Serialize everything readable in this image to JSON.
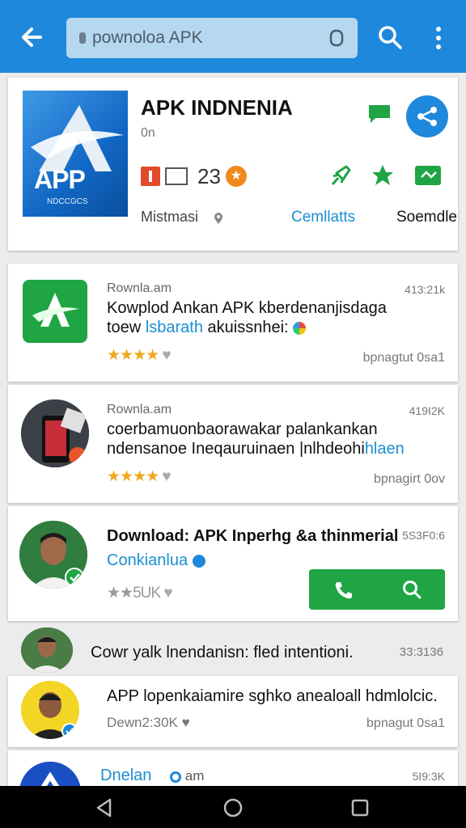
{
  "search": {
    "placeholder": "pownoloa APK"
  },
  "hero": {
    "logo_text": "APP",
    "logo_subtext": "NDCCGCS",
    "title": "APK INDNENIA",
    "subtitle": "0n",
    "count": "23",
    "location": "Mistmasi",
    "link_primary": "Cemllatts",
    "link_secondary": "Soemdle"
  },
  "posts": [
    {
      "name": "Rownla.am",
      "meta": "413:21k",
      "title": "Kowplod Ankan APK kberdenanjisdaga",
      "line2_prefix": "toew",
      "line2_highlight": "lsbarath",
      "line2_suffix": "akuissnhei:",
      "stars": "★★★★",
      "footer": "bpnagtut 0sa1"
    },
    {
      "name": "Rownla.am",
      "meta": "419I2K",
      "title": "coerbamuonbaorawakar palankankan",
      "line2_prefix": "ndensanoe Ineqauruinaen |nlhdeohi",
      "line2_highlight": "hlaen",
      "line2_suffix": "",
      "stars": "★★★★",
      "footer": "bpnagirt 0ov"
    },
    {
      "title": "Download: APK Inperhg &a thinmerial",
      "meta": "5S3F0:6",
      "subtitle": "Conkianlua",
      "stars_text": "★★5UK",
      "footer": ""
    },
    {
      "title": "Cowr yalk lnendanisn: fled intentioni.",
      "meta": "33:3136"
    },
    {
      "title": "APP lopenkaiamire sghko anealoall hdmlolcic.",
      "stats": "Dewn2:30K",
      "footer": "bpnagut 0sa1"
    },
    {
      "name": "Dnelan",
      "name_suffix": "am",
      "meta": "5I9:3K"
    }
  ],
  "icons": {
    "back": "arrow-left-icon",
    "search": "search-icon",
    "more": "more-vertical-icon",
    "share": "share-icon",
    "chat": "chat-icon",
    "call": "phone-icon"
  },
  "colors": {
    "appbar": "#1e88dc",
    "accent_green": "#1fa543",
    "link_blue": "#1a8fd4",
    "star": "#f0a81e"
  }
}
